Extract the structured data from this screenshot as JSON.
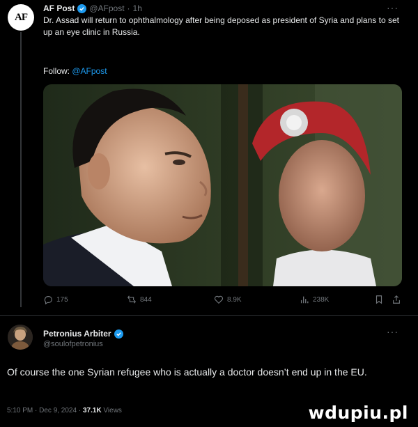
{
  "post": {
    "avatar_text": "AF",
    "author": "AF Post",
    "handle": "@AFpost",
    "time": "1h",
    "more": "···",
    "text": "Dr. Assad will return to ophthalmology after being deposed as president of Syria and plans to set up an eye clinic in Russia.",
    "follow_label": "Follow:",
    "follow_handle": "@AFpost",
    "actions": {
      "replies": "175",
      "reposts": "844",
      "likes": "8.9K",
      "views": "238K"
    }
  },
  "reply": {
    "author": "Petronius Arbiter",
    "handle": "@soulofpetronius",
    "more": "···",
    "text": "Of course the one Syrian refugee who is actually a doctor doesn’t end up in the EU.",
    "time": "5:10 PM · Dec 9, 2024 ·",
    "views_count": "37.1K",
    "views_label": "Views"
  },
  "watermark": "wdupiu.pl",
  "colors": {
    "background": "#000000",
    "text": "#e7e9ea",
    "muted": "#71767b",
    "accent": "#1d9bf0"
  },
  "icons": [
    "verified-badge-icon",
    "more-icon",
    "reply-icon",
    "repost-icon",
    "like-icon",
    "views-icon",
    "bookmark-icon",
    "share-icon"
  ]
}
